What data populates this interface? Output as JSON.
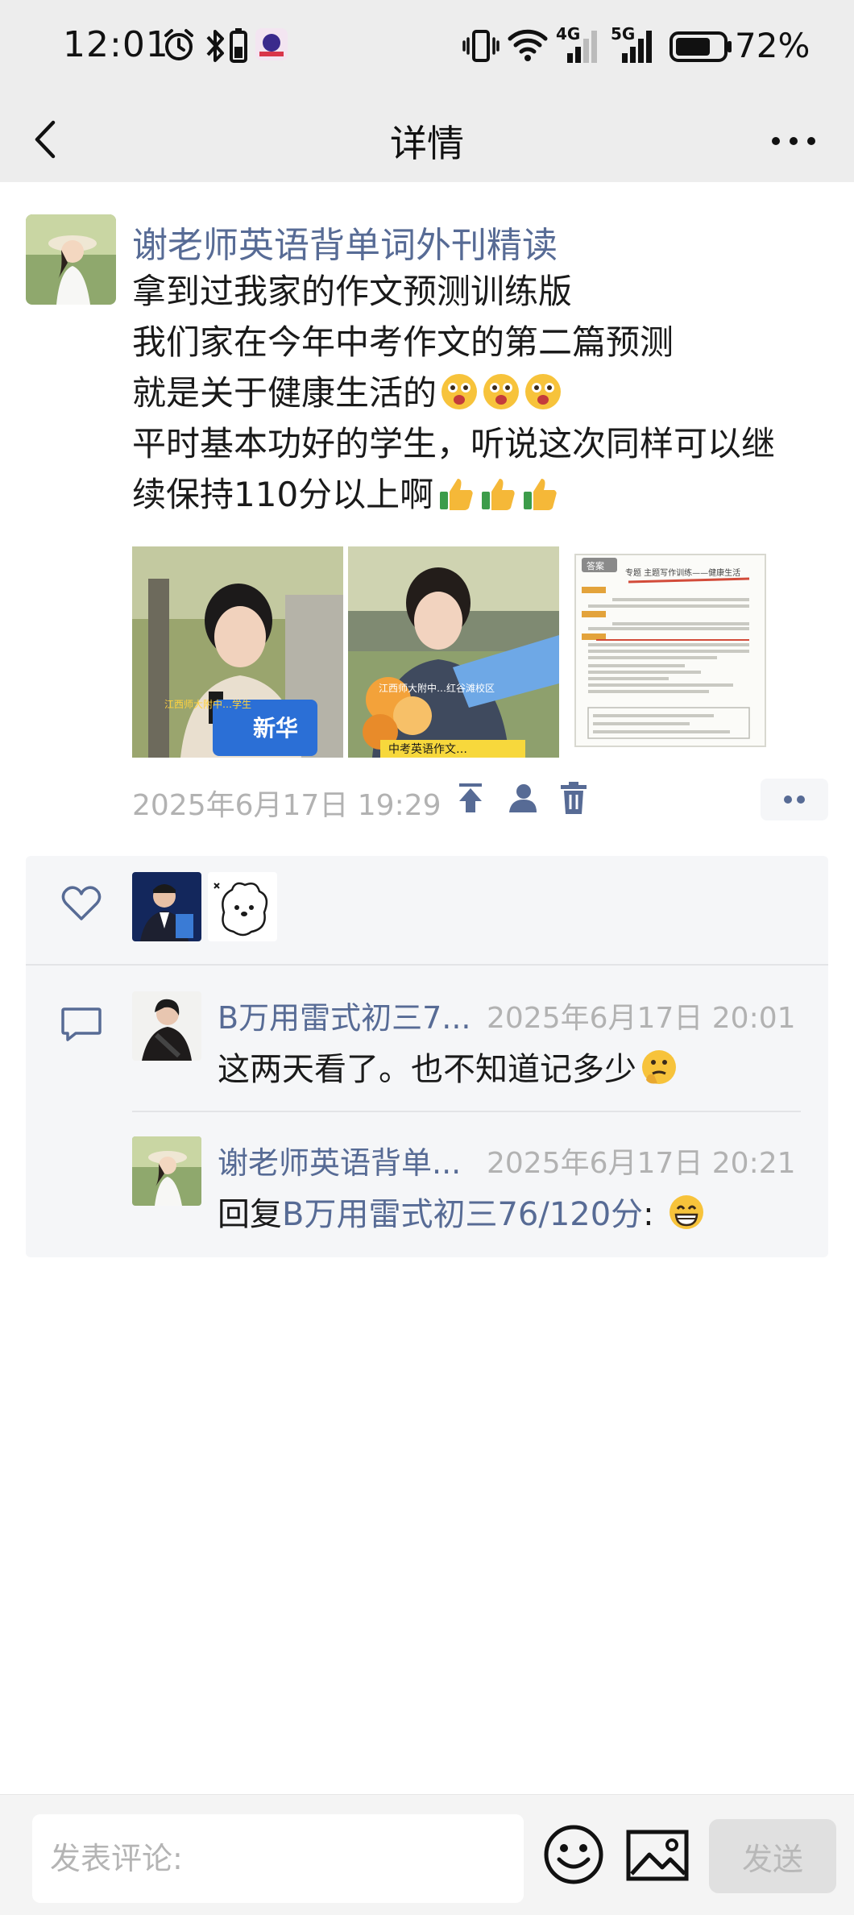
{
  "status_bar": {
    "time": "12:01",
    "network_1": "4G",
    "network_2": "5G",
    "battery_percent": "72%"
  },
  "nav": {
    "title": "详情"
  },
  "post": {
    "author": "谢老师英语背单词外刊精读",
    "lines": [
      "拿到过我家的作文预测训练版",
      "我们家在今年中考作文的第二篇预测",
      "就是关于健康生活的",
      "平时基本功好的学生，听说这次同样可以继",
      "续保持110分以上啊"
    ],
    "images": [
      {
        "caption": "江西师大附中…学生",
        "tag": "新华"
      },
      {
        "caption": "江西师大附中…红谷滩校区",
        "bottom": "中考英语作文…"
      },
      {
        "doc_heading": "专题 主题写作训练——健康生活",
        "tag": "答案"
      }
    ],
    "timestamp": "2025年6月17日 19:29"
  },
  "comments": [
    {
      "name": "B万用雷式初三7...",
      "time": "2025年6月17日 20:01",
      "text": "这两天看了。也不知道记多少"
    },
    {
      "name": "谢老师英语背单...",
      "time": "2025年6月17日 20:21",
      "reply_prefix": "回复",
      "reply_to": "B万用雷式初三76/120分",
      "text": ":"
    }
  ],
  "input": {
    "placeholder": "发表评论:"
  },
  "send_label": "发送",
  "colors": {
    "link": "#576b95",
    "meta": "#b2b2b2",
    "panel_bg": "#f5f6f8",
    "bar_bg": "#ededed"
  },
  "icons": [
    "back-arrow-icon",
    "more-dots-icon",
    "pin-top-icon",
    "person-icon",
    "trash-icon",
    "heart-icon",
    "comment-bubble-icon",
    "emoji-icon",
    "image-icon"
  ]
}
